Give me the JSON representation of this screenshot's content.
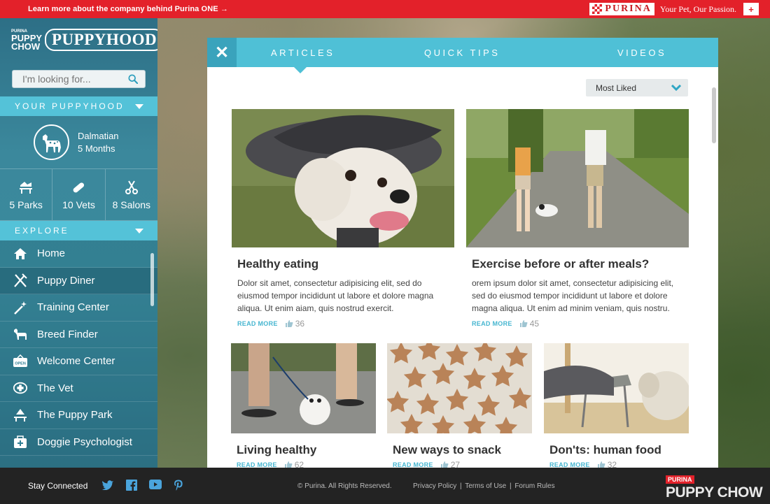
{
  "topbar": {
    "learn_more": "Learn more about the company behind Purina ONE →",
    "brand": "PURINA",
    "tagline": "Your Pet, Our Passion.",
    "plus": "+"
  },
  "sidebar": {
    "brand_small": [
      "PURINA",
      "PUPPY",
      "CHOW"
    ],
    "brand_title": "PUPPYHOOD",
    "search_placeholder": "I'm looking for...",
    "your_puppyhood": "YOUR PUPPYHOOD",
    "dog": {
      "breed": "Dalmatian",
      "age": "5 Months"
    },
    "stats": [
      "5 Parks",
      "10 Vets",
      "8 Salons"
    ],
    "explore": "EXPLORE",
    "nav": [
      "Home",
      "Puppy Diner",
      "Training Center",
      "Breed Finder",
      "Welcome Center",
      "The Vet",
      "The Puppy Park",
      "Doggie Psychologist"
    ],
    "open_sign": "OPEN"
  },
  "panel": {
    "close": "✕",
    "tabs": [
      "ARTICLES",
      "QUICK TIPS",
      "VIDEOS"
    ],
    "sort": "Most Liked",
    "articles": [
      {
        "title": "Healthy eating",
        "body": "Dolor sit amet, consectetur adipisicing elit, sed do eiusmod tempor incididunt ut labore et dolore magna aliqua. Ut enim aiam, quis nostrud exercit.",
        "read_more": "READ MORE",
        "likes": "36"
      },
      {
        "title": "Exercise before or after meals?",
        "body": "orem ipsum dolor sit amet, consectetur adipisicing elit, sed do eiusmod tempor incididunt ut labore et dolore magna aliqua. Ut enim ad minim veniam, quis nostru.",
        "read_more": "READ MORE",
        "likes": "45"
      },
      {
        "title": "Living healthy",
        "read_more": "READ MORE",
        "likes": "62"
      },
      {
        "title": "New ways to snack",
        "read_more": "READ MORE",
        "likes": "27"
      },
      {
        "title": "Don'ts: human food",
        "read_more": "READ MORE",
        "likes": "32"
      }
    ]
  },
  "footer": {
    "stay_connected": "Stay Connected",
    "copyright": "© Purina. All Rights Reserved.",
    "links": [
      "Privacy Policy",
      "|",
      "Terms of Use",
      "|",
      "Forum Rules"
    ],
    "logo_top": "PURINA",
    "logo_bottom": "PUPPY CHOW"
  },
  "colors": {
    "accent": "#4fc0d6",
    "topbar": "#e3212a",
    "footer": "#232323",
    "link": "#46b6d0"
  }
}
